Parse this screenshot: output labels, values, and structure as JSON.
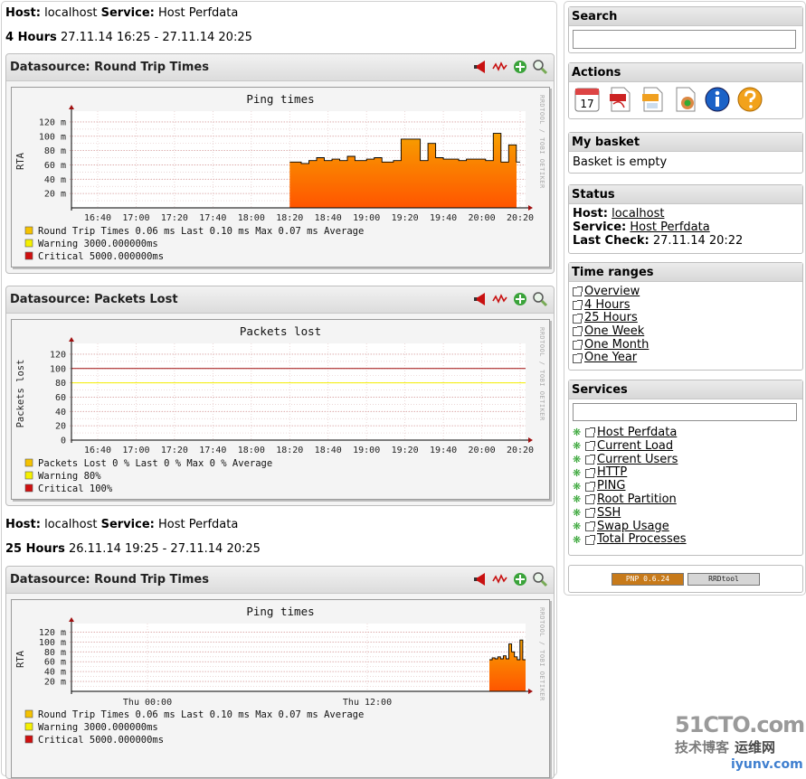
{
  "sections": [
    {
      "host_label": "Host:",
      "host": "localhost",
      "service_label": "Service:",
      "service": "Host Perfdata",
      "range_label": "4 Hours",
      "range": "27.11.14 16:25 - 27.11.14 20:25"
    },
    {
      "host_label": "Host:",
      "host": "localhost",
      "service_label": "Service:",
      "service": "Host Perfdata",
      "range_label": "25 Hours",
      "range": "26.11.14 19:25 - 27.11.14 20:25"
    }
  ],
  "datasources": [
    {
      "title": "Datasource: Round Trip Times",
      "graph_title": "Ping times",
      "side_text": "RRDTOOL / TOBI OETIKER",
      "ylabel": "RTA",
      "legend": [
        {
          "swatch": "#f5c200",
          "text": "Round Trip Times      0.06 ms Last      0.10 ms Max      0.07 ms Average"
        },
        {
          "swatch": "#f5f000",
          "text": "Warning   3000.000000ms"
        },
        {
          "swatch": "#d01010",
          "text": "Critical  5000.000000ms"
        }
      ]
    },
    {
      "title": "Datasource: Packets Lost",
      "graph_title": "Packets lost",
      "side_text": "RRDTOOL / TOBI OETIKER",
      "ylabel": "Packets lost",
      "legend": [
        {
          "swatch": "#f5c200",
          "text": "Packets Lost     0 % Last      0 % Max      0 % Average"
        },
        {
          "swatch": "#f5f000",
          "text": "Warning  80%"
        },
        {
          "swatch": "#d01010",
          "text": "Critical 100%"
        }
      ]
    },
    {
      "title": "Datasource: Round Trip Times",
      "graph_title": "Ping times",
      "side_text": "RRDTOOL / TOBI OETIKER",
      "ylabel": "RTA",
      "legend": [
        {
          "swatch": "#f5c200",
          "text": "Round Trip Times      0.06 ms Last      0.10 ms Max      0.07 ms Average"
        },
        {
          "swatch": "#f5f000",
          "text": "Warning   3000.000000ms"
        },
        {
          "swatch": "#d01010",
          "text": "Critical  5000.000000ms"
        }
      ]
    }
  ],
  "chart_data": [
    {
      "type": "area",
      "title": "Ping times",
      "ylabel": "RTA",
      "yticks": [
        "20 m",
        "40 m",
        "60 m",
        "80 m",
        "100 m",
        "120 m"
      ],
      "ylim": [
        0,
        130
      ],
      "x_ticks": [
        "16:40",
        "17:00",
        "17:20",
        "17:40",
        "18:00",
        "18:20",
        "18:40",
        "19:00",
        "19:20",
        "19:40",
        "20:00",
        "20:20"
      ],
      "series": [
        {
          "name": "Round Trip Times",
          "x": [
            "18:20",
            "18:22",
            "18:24",
            "18:26",
            "18:28",
            "18:30",
            "18:32",
            "18:34",
            "18:36",
            "18:38",
            "18:40",
            "18:42",
            "18:44",
            "18:46",
            "18:48",
            "18:50",
            "18:52",
            "18:54",
            "18:56",
            "18:58",
            "19:00",
            "19:02",
            "19:04",
            "19:06",
            "19:08",
            "19:10",
            "19:12",
            "19:14",
            "19:16",
            "19:18",
            "19:20",
            "19:22",
            "19:24",
            "19:26",
            "19:28",
            "19:30",
            "19:32",
            "19:34",
            "19:36",
            "19:38",
            "19:40",
            "19:42",
            "19:44",
            "19:46",
            "19:48",
            "19:50",
            "19:52",
            "19:54",
            "19:56",
            "19:58",
            "20:00",
            "20:02",
            "20:04",
            "20:06",
            "20:08",
            "20:10",
            "20:12",
            "20:14",
            "20:16",
            "20:18",
            "20:20"
          ],
          "values": [
            64,
            64,
            64,
            62,
            62,
            66,
            66,
            70,
            70,
            66,
            66,
            68,
            68,
            66,
            66,
            72,
            72,
            66,
            66,
            66,
            68,
            68,
            70,
            70,
            64,
            64,
            64,
            66,
            66,
            96,
            96,
            96,
            96,
            96,
            66,
            66,
            90,
            90,
            70,
            70,
            68,
            68,
            68,
            68,
            66,
            66,
            68,
            68,
            68,
            68,
            68,
            66,
            66,
            104,
            104,
            64,
            64,
            88,
            88,
            64,
            64
          ]
        }
      ]
    },
    {
      "type": "line",
      "title": "Packets lost",
      "ylabel": "Packets lost",
      "yticks": [
        "0",
        "20",
        "40",
        "60",
        "80",
        "100",
        "120"
      ],
      "ylim": [
        0,
        130
      ],
      "x_ticks": [
        "16:40",
        "17:00",
        "17:20",
        "17:40",
        "18:00",
        "18:20",
        "18:40",
        "19:00",
        "19:20",
        "19:40",
        "20:00",
        "20:20"
      ],
      "series": [
        {
          "name": "Packets Lost",
          "values": [
            0,
            0
          ]
        },
        {
          "name": "Warning",
          "values": [
            80,
            80
          ]
        },
        {
          "name": "Critical",
          "values": [
            100,
            100
          ]
        }
      ]
    },
    {
      "type": "area",
      "title": "Ping times",
      "ylabel": "RTA",
      "yticks": [
        "20 m",
        "40 m",
        "60 m",
        "80 m",
        "100 m",
        "120 m"
      ],
      "ylim": [
        0,
        130
      ],
      "x_ticks": [
        "Thu 00:00",
        "Thu 12:00"
      ],
      "series": [
        {
          "name": "Round Trip Times",
          "x": [
            "Thu 18:20",
            "Thu 18:30",
            "Thu 18:40",
            "Thu 18:50",
            "Thu 19:00",
            "Thu 19:10",
            "Thu 19:20",
            "Thu 19:30",
            "Thu 19:40",
            "Thu 19:50",
            "Thu 20:00",
            "Thu 20:10",
            "Thu 20:20"
          ],
          "values": [
            64,
            68,
            66,
            70,
            66,
            72,
            66,
            96,
            80,
            70,
            64,
            104,
            64
          ]
        }
      ]
    }
  ],
  "sidebar": {
    "search": {
      "title": "Search",
      "placeholder": ""
    },
    "actions": {
      "title": "Actions",
      "icons": [
        "calendar-icon",
        "pdf-icon",
        "xml-icon",
        "basket-add-icon",
        "info-icon",
        "help-icon"
      ],
      "calendar_day": "17"
    },
    "basket": {
      "title": "My basket",
      "text": "Basket is empty"
    },
    "status": {
      "title": "Status",
      "host_label": "Host:",
      "host": "localhost",
      "service_label": "Service:",
      "service": "Host Perfdata",
      "last_check_label": "Last Check:",
      "last_check": "27.11.14 20:22"
    },
    "time_ranges": {
      "title": "Time ranges",
      "items": [
        "Overview",
        "4 Hours",
        "25 Hours",
        "One Week",
        "One Month",
        "One Year"
      ]
    },
    "services": {
      "title": "Services",
      "filter_placeholder": "",
      "items": [
        "Host Perfdata",
        "Current Load",
        "Current Users",
        "HTTP",
        "PING",
        "Root Partition",
        "SSH",
        "Swap Usage",
        "Total Processes"
      ]
    },
    "badges": [
      "PNP 0.6.24",
      "RRDtool"
    ]
  },
  "watermark": {
    "line1": "51CTO.com",
    "line2": "技术博客",
    "line3": "运维网",
    "line4": "iyunv.com"
  },
  "colors": {
    "accent_area_top": "#f7a000",
    "accent_area_bottom": "#ff5500",
    "warning": "#f5f000",
    "critical": "#a01010"
  }
}
